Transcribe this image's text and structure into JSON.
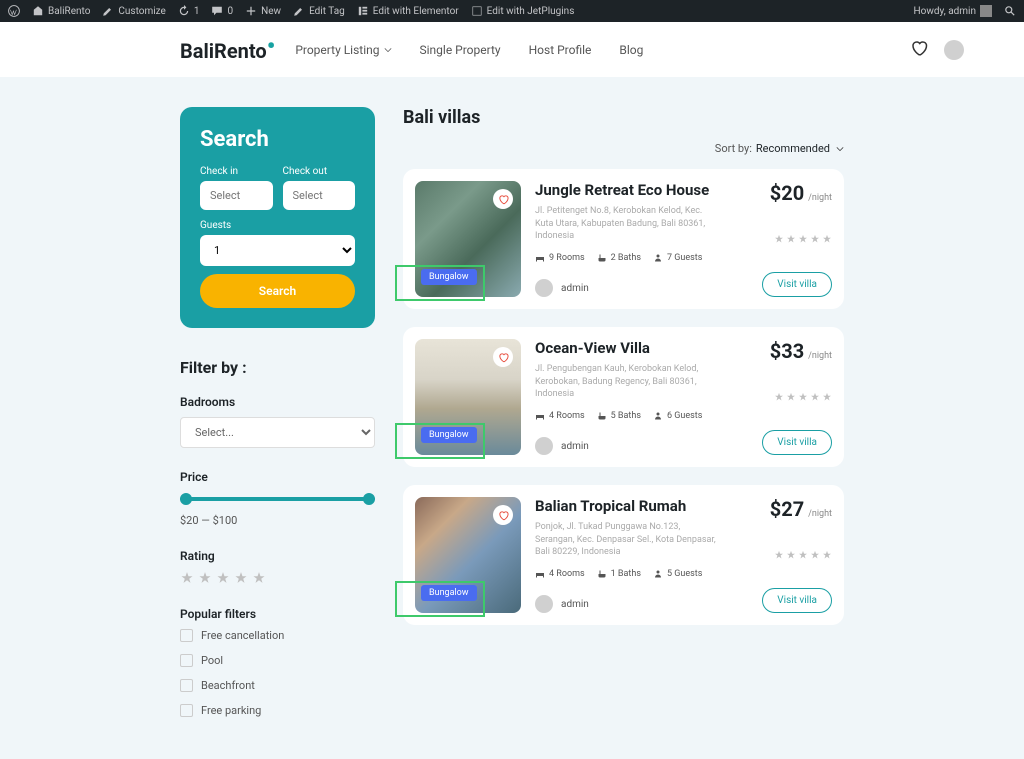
{
  "wpbar": {
    "site": "BaliRento",
    "customize": "Customize",
    "updates": "1",
    "comments": "0",
    "new": "New",
    "edit_tag": "Edit Tag",
    "elementor": "Edit with Elementor",
    "jetplugins": "Edit with JetPlugins",
    "howdy": "Howdy, admin"
  },
  "header": {
    "logo": "BaliRento",
    "nav": [
      "Property Listing",
      "Single Property",
      "Host Profile",
      "Blog"
    ]
  },
  "search": {
    "title": "Search",
    "checkin_label": "Check in",
    "checkout_label": "Check out",
    "select_placeholder": "Select",
    "guests_label": "Guests",
    "guests_value": "1",
    "button": "Search"
  },
  "filter": {
    "title": "Filter by :",
    "bedrooms_label": "Badrooms",
    "bedrooms_placeholder": "Select...",
    "price_label": "Price",
    "price_range": "$20 — $100",
    "rating_label": "Rating",
    "popular_label": "Popular filters",
    "popular": [
      "Free cancellation",
      "Pool",
      "Beachfront",
      "Free parking"
    ]
  },
  "content": {
    "title": "Bali villas",
    "sort_label": "Sort by:",
    "sort_value": "Recommended"
  },
  "listings": [
    {
      "title": "Jungle Retreat Eco House",
      "address": "Jl. Petitenget No.8, Kerobokan Kelod, Kec. Kuta Utara, Kabupaten Badung, Bali 80361, Indonesia",
      "rooms": "9 Rooms",
      "baths": "2 Baths",
      "guests": "7 Guests",
      "author": "admin",
      "tag": "Bungalow",
      "price": "$20",
      "unit": "/night",
      "visit": "Visit villa",
      "img_css": "linear-gradient(135deg,#5a7a6a 0%,#7a9a8a 30%,#4a6a5a 60%,#8aaab0 100%)"
    },
    {
      "title": "Ocean-View Villa",
      "address": "Jl. Pengubengan Kauh, Kerobokan Kelod, Kerobokan, Badung Regency, Bali 80361, Indonesia",
      "rooms": "4 Rooms",
      "baths": "5 Baths",
      "guests": "6 Guests",
      "author": "admin",
      "tag": "Bungalow",
      "price": "$33",
      "unit": "/night",
      "visit": "Visit villa",
      "img_css": "linear-gradient(180deg,#e8e4d8 0%,#d8d4c8 35%,#b0a890 60%,#6a8a9a 100%)"
    },
    {
      "title": "Balian Tropical Rumah",
      "address": "Ponjok, Jl. Tukad Punggawa No.123, Serangan, Kec. Denpasar Sel., Kota Denpasar, Bali 80229, Indonesia",
      "rooms": "4 Rooms",
      "baths": "1 Baths",
      "guests": "5 Guests",
      "author": "admin",
      "tag": "Bungalow",
      "price": "$27",
      "unit": "/night",
      "visit": "Visit villa",
      "img_css": "linear-gradient(135deg,#8a6a5a 0%,#c8a888 25%,#7a9aba 55%,#4a6a7a 100%)"
    }
  ]
}
